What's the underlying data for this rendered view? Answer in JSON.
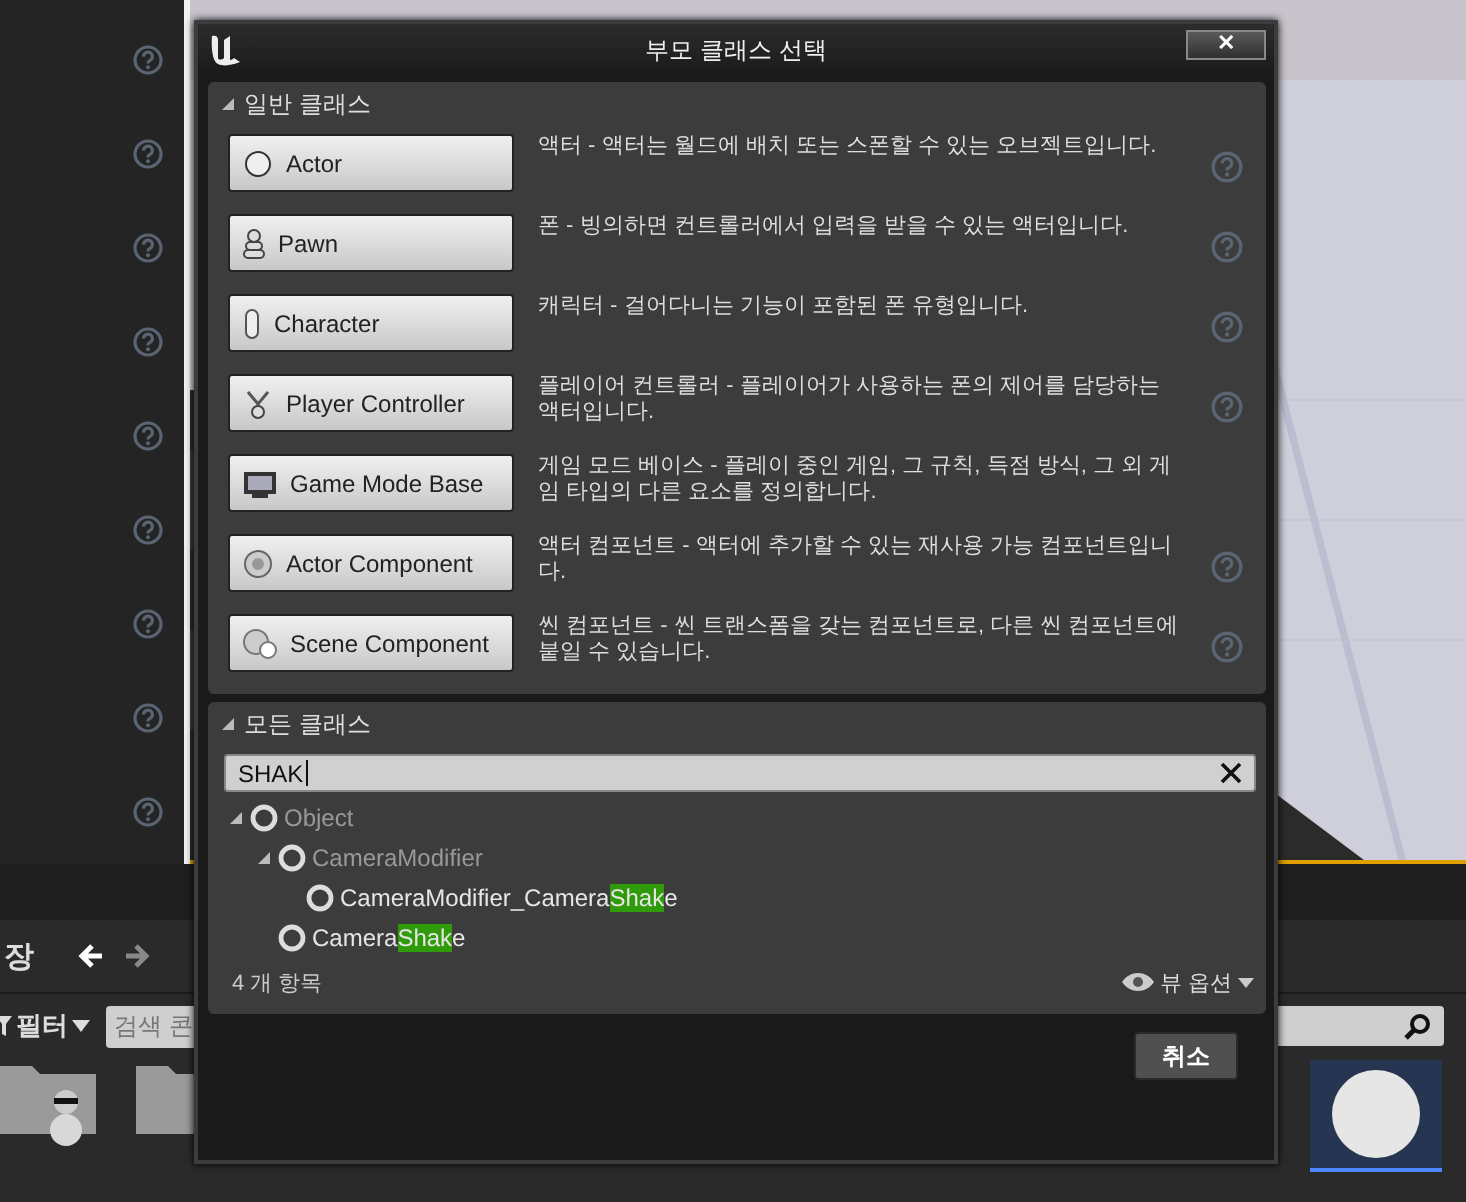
{
  "dialog": {
    "title": "부모 클래스 선택",
    "close_label": "✕"
  },
  "common_section": {
    "title": "일반 클래스",
    "expanded": true,
    "classes": [
      {
        "kind": "actor",
        "label": "Actor",
        "description": "액터 - 액터는 월드에 배치 또는 스폰할 수 있는 오브젝트입니다."
      },
      {
        "kind": "pawn",
        "label": "Pawn",
        "description": "폰 - 빙의하면 컨트롤러에서 입력을 받을 수 있는 액터입니다."
      },
      {
        "kind": "character",
        "label": "Character",
        "description": "캐릭터 - 걸어다니는 기능이 포함된 폰 유형입니다."
      },
      {
        "kind": "controller",
        "label": "Player Controller",
        "description": "플레이어 컨트롤러 - 플레이어가 사용하는 폰의 제어를 담당하는 액터입니다."
      },
      {
        "kind": "gamemode",
        "label": "Game Mode Base",
        "description": "게임 모드 베이스 - 플레이 중인 게임, 그 규칙, 득점 방식, 그 외 게임 타입의 다른 요소를 정의합니다."
      },
      {
        "kind": "component",
        "label": "Actor Component",
        "description": "액터 컴포넌트 - 액터에 추가할 수 있는 재사용 가능 컴포넌트입니다."
      },
      {
        "kind": "scene",
        "label": "Scene Component",
        "description": "씬 컴포넌트 - 씬 트랜스폼을 갖는 컴포넌트로, 다른 씬 컴포넌트에 붙일 수 있습니다."
      }
    ]
  },
  "all_section": {
    "title": "모든 클래스",
    "expanded": true,
    "search": {
      "value": "SHAK"
    },
    "tree": [
      {
        "label_parts": [
          "Object"
        ],
        "dimmed": true,
        "expanded": true,
        "children": [
          {
            "label_parts": [
              "CameraModifier"
            ],
            "dimmed": true,
            "expanded": true,
            "children": [
              {
                "label_parts": [
                  "CameraModifier_Camera",
                  "Shak",
                  "e"
                ],
                "dimmed": false
              }
            ]
          },
          {
            "label_parts": [
              "Camera",
              "Shak",
              "e"
            ],
            "dimmed": false
          }
        ]
      }
    ],
    "count": "4 개 항목",
    "view_options": "뷰 옵션"
  },
  "cancel_button": "취소",
  "content_browser": {
    "save_label": "장",
    "filter_label": "필터",
    "search_placeholder": "검색 콘"
  }
}
